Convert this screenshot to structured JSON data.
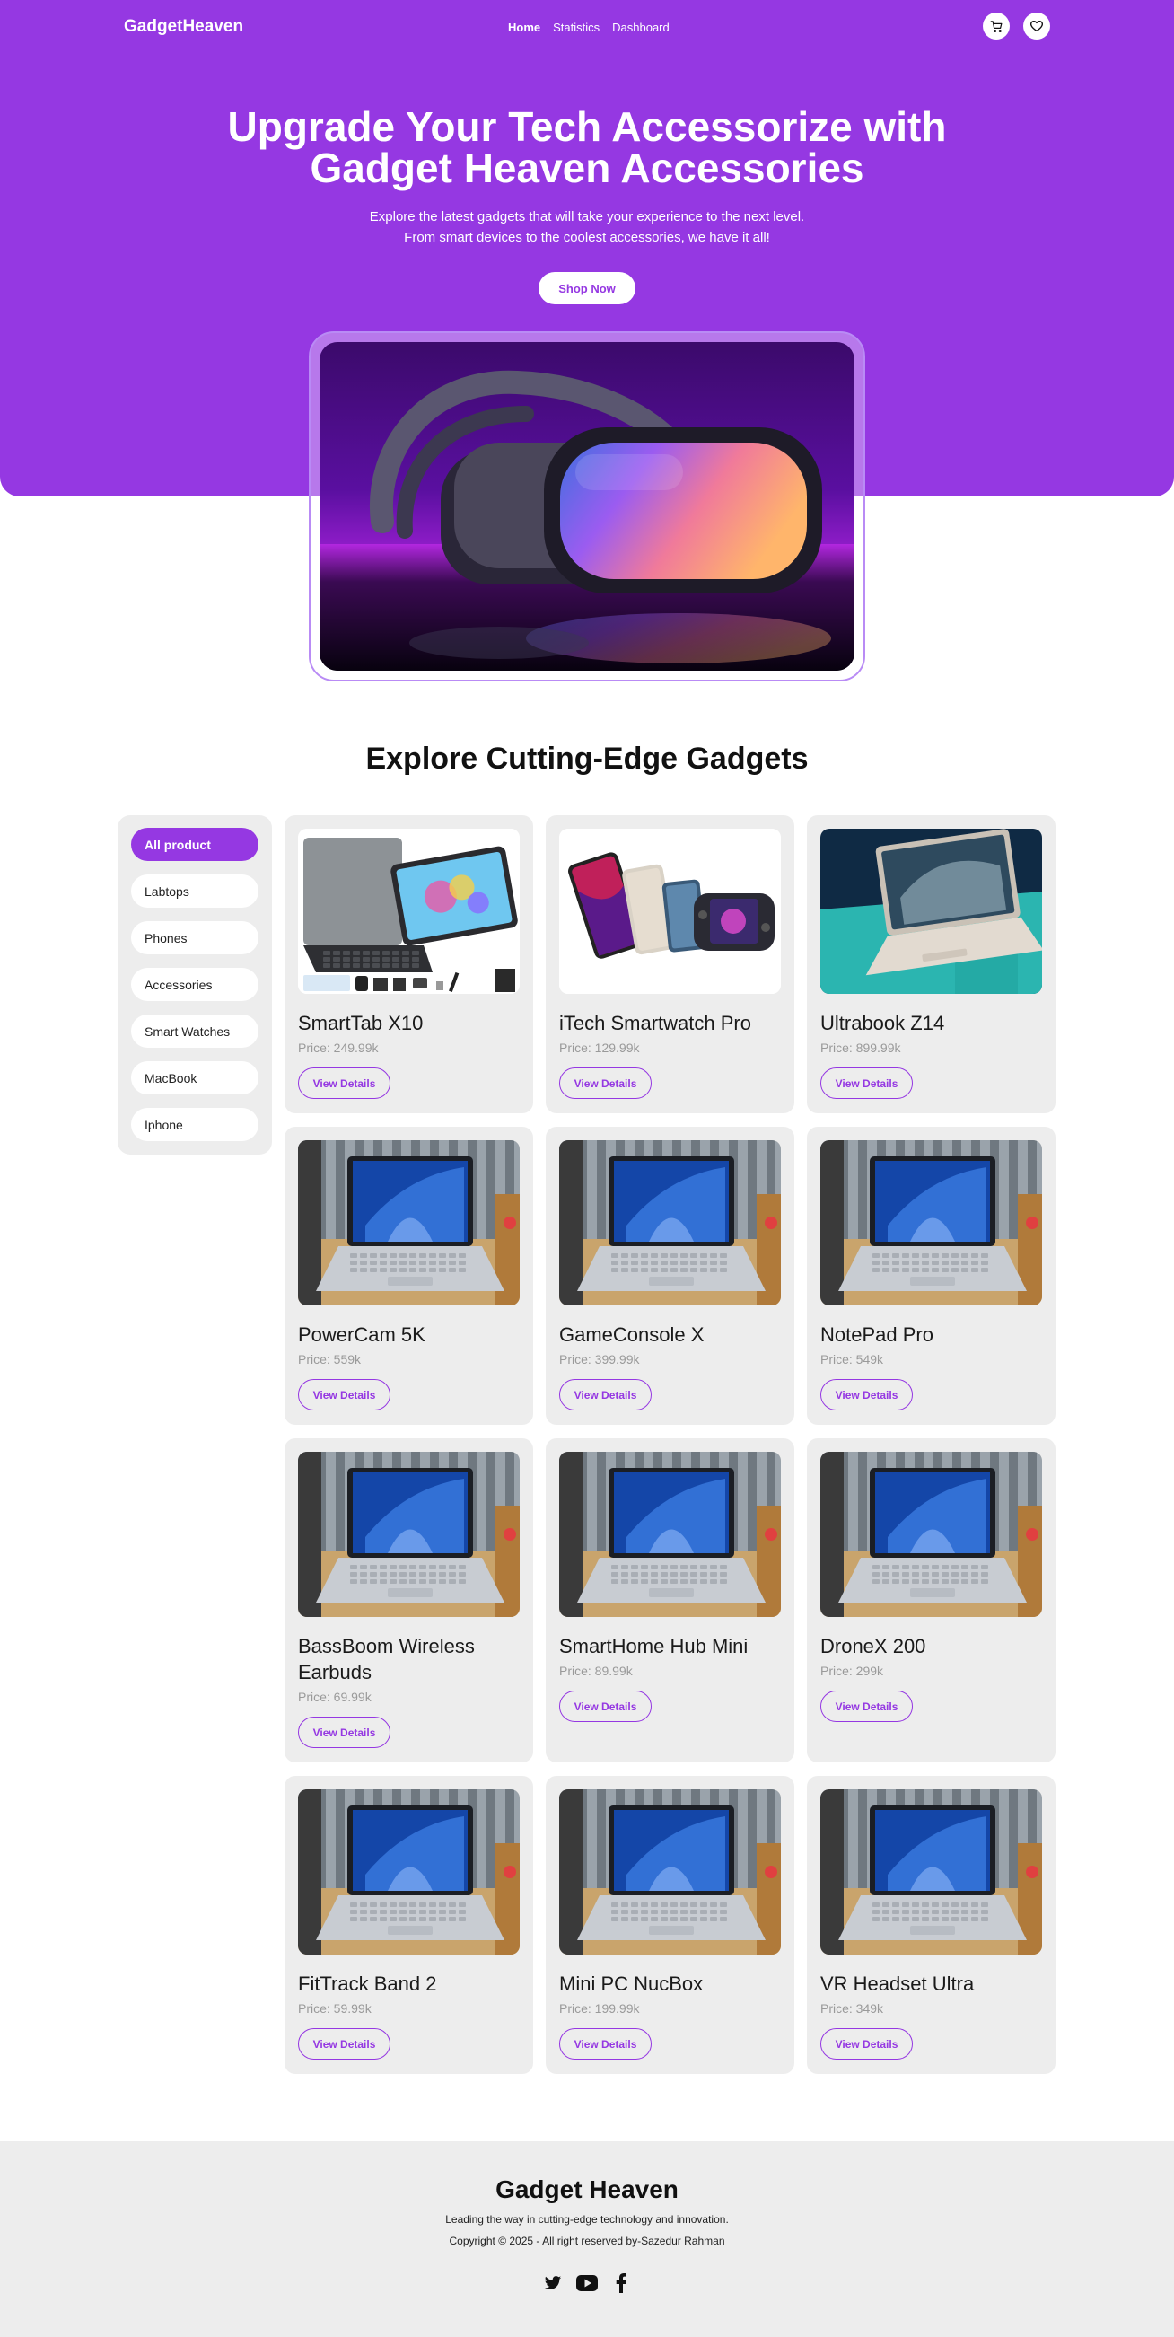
{
  "brand": "GadgetHeaven",
  "nav": {
    "links": [
      "Home",
      "Statistics",
      "Dashboard"
    ],
    "active": "Home"
  },
  "icons": {
    "cart": "cart-icon",
    "wishlist": "heart-icon"
  },
  "colors": {
    "primary": "#9538e2",
    "surface": "#ededed",
    "muted": "#9a9a9a"
  },
  "hero": {
    "title_line1": "Upgrade Your Tech Accessorize with",
    "title_line2": "Gadget Heaven Accessories",
    "subtitle_line1": "Explore the latest gadgets that will take your experience to the next level.",
    "subtitle_line2": "From smart devices to the coolest accessories, we have it all!",
    "cta": "Shop Now"
  },
  "explore": {
    "title": "Explore Cutting-Edge Gadgets"
  },
  "categories": [
    "All product",
    "Labtops",
    "Phones",
    "Accessories",
    "Smart Watches",
    "MacBook",
    "Iphone"
  ],
  "active_category": "All product",
  "products": [
    {
      "name": "SmartTab X10",
      "price": "Price: 249.99k",
      "image": "tablet-keyboard"
    },
    {
      "name": "iTech Smartwatch Pro",
      "price": "Price: 129.99k",
      "image": "devices"
    },
    {
      "name": "Ultrabook Z14",
      "price": "Price: 899.99k",
      "image": "ultrabook"
    },
    {
      "name": "PowerCam 5K",
      "price": "Price: 559k",
      "image": "laptop"
    },
    {
      "name": "GameConsole X",
      "price": "Price: 399.99k",
      "image": "laptop"
    },
    {
      "name": "NotePad Pro",
      "price": "Price: 549k",
      "image": "laptop"
    },
    {
      "name": "BassBoom Wireless Earbuds",
      "price": "Price: 69.99k",
      "image": "laptop"
    },
    {
      "name": "SmartHome Hub Mini",
      "price": "Price: 89.99k",
      "image": "laptop"
    },
    {
      "name": "DroneX 200",
      "price": "Price: 299k",
      "image": "laptop"
    },
    {
      "name": "FitTrack Band 2",
      "price": "Price: 59.99k",
      "image": "laptop"
    },
    {
      "name": "Mini PC NucBox",
      "price": "Price: 199.99k",
      "image": "laptop"
    },
    {
      "name": "VR Headset Ultra",
      "price": "Price: 349k",
      "image": "laptop"
    }
  ],
  "view_details_label": "View Details",
  "footer": {
    "title": "Gadget Heaven",
    "tagline": "Leading the way in cutting-edge technology and innovation.",
    "copyright": "Copyright © 2025 - All right reserved by-Sazedur Rahman",
    "socials": [
      "twitter-icon",
      "youtube-icon",
      "facebook-icon"
    ]
  }
}
